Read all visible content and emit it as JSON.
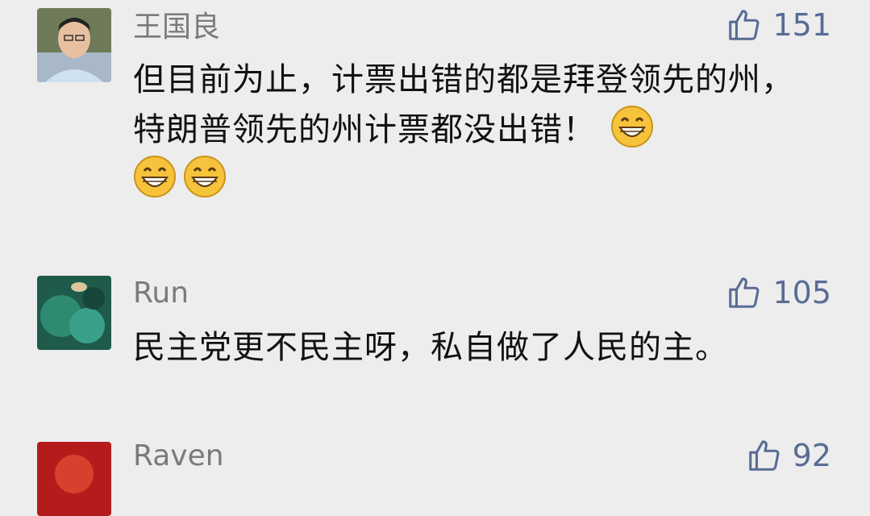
{
  "comments": [
    {
      "author": "王国良",
      "likes": "151",
      "text": "但目前为止，计票出错的都是拜登领先的州，特朗普领先的州计票都没出错！",
      "trailing_emojis": [
        "grin-icon",
        "grin-icon",
        "grin-icon"
      ]
    },
    {
      "author": "Run",
      "likes": "105",
      "text": "民主党更不民主呀，私自做了人民的主。"
    },
    {
      "author": "Raven",
      "likes": "92",
      "text": ""
    }
  ],
  "colors": {
    "background": "#ededed",
    "link": "#586c94",
    "name": "#7a7a7a"
  }
}
